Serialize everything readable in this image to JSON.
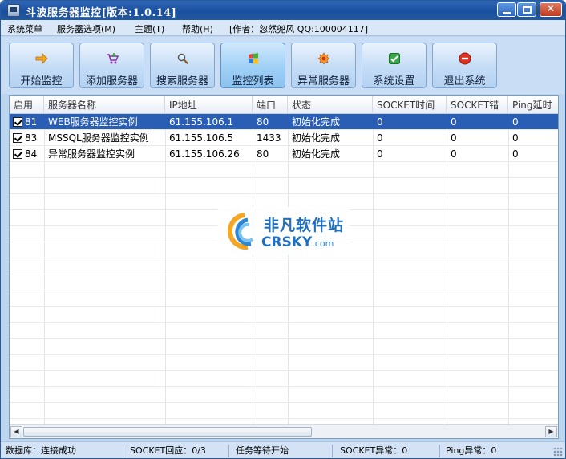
{
  "window": {
    "title": "斗波服务器监控[版本:1.0.14]"
  },
  "menu": {
    "items": [
      {
        "label": "系统菜单"
      },
      {
        "label": "服务器选项(M)"
      },
      {
        "label": "主题(T)"
      },
      {
        "label": "帮助(H)"
      }
    ],
    "author_info": "[作者：忽然兜风 QQ:100004117]"
  },
  "toolbar": {
    "buttons": [
      {
        "label": "开始监控",
        "icon": "arrow-right-icon"
      },
      {
        "label": "添加服务器",
        "icon": "cart-add-icon"
      },
      {
        "label": "搜索服务器",
        "icon": "magnifier-icon"
      },
      {
        "label": "监控列表",
        "icon": "windows-flag-icon",
        "active": true
      },
      {
        "label": "异常服务器",
        "icon": "warning-burst-icon"
      },
      {
        "label": "系统设置",
        "icon": "settings-check-icon"
      },
      {
        "label": "退出系统",
        "icon": "stop-icon"
      }
    ]
  },
  "grid": {
    "columns": [
      "启用",
      "服务器名称",
      "IP地址",
      "端口",
      "状态",
      "SOCKET时间",
      "SOCKET错",
      "Ping延时"
    ],
    "rows": [
      {
        "id": "81",
        "name": "WEB服务器监控实例",
        "ip": "61.155.106.1",
        "port": "80",
        "status": "初始化完成",
        "socket_time": "0",
        "socket_err": "0",
        "ping": "0",
        "enabled": true,
        "selected": true
      },
      {
        "id": "83",
        "name": "MSSQL服务器监控实例",
        "ip": "61.155.106.5",
        "port": "1433",
        "status": "初始化完成",
        "socket_time": "0",
        "socket_err": "0",
        "ping": "0",
        "enabled": true,
        "selected": false
      },
      {
        "id": "84",
        "name": "异常服务器监控实例",
        "ip": "61.155.106.26",
        "port": "80",
        "status": "初始化完成",
        "socket_time": "0",
        "socket_err": "0",
        "ping": "0",
        "enabled": true,
        "selected": false
      }
    ]
  },
  "watermark": {
    "cn": "非凡软件站",
    "en": "CRSKY",
    "domain": ".com"
  },
  "status": {
    "database": "数据库：连接成功",
    "socket_reply": "SOCKET回应：0/3",
    "task": "任务等待开始",
    "socket_error": "SOCKET异常：0",
    "ping_error": "Ping异常：0"
  },
  "colors": {
    "selection": "#2a5eb5",
    "titlebar": "#1a4f9e",
    "accent_text": "#1e6fc2"
  }
}
